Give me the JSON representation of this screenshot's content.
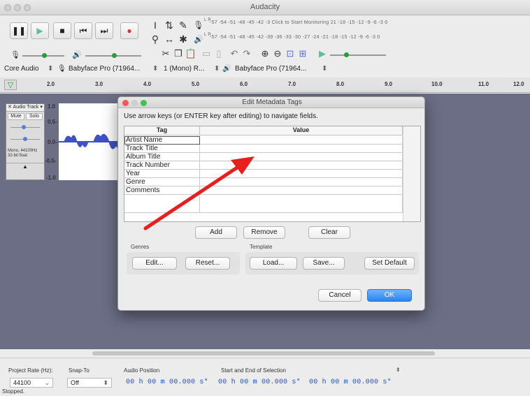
{
  "window": {
    "title": "Audacity"
  },
  "toolbar": {
    "transport": [
      "pause-icon",
      "play-icon",
      "stop-icon",
      "skip-start-icon",
      "skip-end-icon",
      "record-icon"
    ],
    "meter_rec_scale": "-57 -54 -51 -48 -45 -42 -3 Click to Start Monitoring 21 -18 -15 -12 -9 -6 -3 0",
    "meter_play_scale": "-57 -54 -51 -48 -45 -42 -39 -36 -33 -30 -27 -24 -21 -18 -15 -12 -9 -6 -3 0",
    "meter_rec_lr": "L\nR",
    "meter_play_lr": "L\nR"
  },
  "devices": {
    "host": "Core Audio",
    "input": "Babyface Pro (71964...",
    "channels": "1 (Mono) R...",
    "output": "Babyface Pro (71964..."
  },
  "ruler": {
    "ticks": [
      "2.0",
      "3.0",
      "4.0",
      "5.0",
      "6.0",
      "7.0",
      "8.0",
      "9.0",
      "10.0",
      "11.0",
      "12.0"
    ]
  },
  "track": {
    "name": "Audio Track",
    "mute": "Mute",
    "solo": "Solo",
    "info": "Mono, 44100Hz\n32-bit float",
    "scale": [
      "1.0",
      "0.5-",
      "0.0-",
      "-0.5-",
      "-1.0"
    ]
  },
  "dialog": {
    "title": "Edit Metadata Tags",
    "instruction": "Use arrow keys (or ENTER key after editing) to navigate fields.",
    "col_tag": "Tag",
    "col_value": "Value",
    "rows": [
      {
        "tag": "Artist Name",
        "value": ""
      },
      {
        "tag": "Track Title",
        "value": ""
      },
      {
        "tag": "Album Title",
        "value": ""
      },
      {
        "tag": "Track Number",
        "value": ""
      },
      {
        "tag": "Year",
        "value": ""
      },
      {
        "tag": "Genre",
        "value": ""
      },
      {
        "tag": "Comments",
        "value": ""
      },
      {
        "tag": "",
        "value": ""
      }
    ],
    "add": "Add",
    "remove": "Remove",
    "clear": "Clear",
    "genres_label": "Genres",
    "template_label": "Template",
    "edit": "Edit...",
    "reset": "Reset...",
    "load": "Load...",
    "save": "Save...",
    "set_default": "Set Default",
    "cancel": "Cancel",
    "ok": "OK"
  },
  "bottom": {
    "project_rate_label": "Project Rate (Hz):",
    "project_rate": "44100",
    "snap_label": "Snap-To",
    "snap": "Off",
    "audio_position_label": "Audio Position",
    "selection_label": "Start and End of Selection",
    "audio_position": "00 h 00 m 00.000 s*",
    "sel_start": "00 h 00 m 00.000 s*",
    "sel_end": "00 h 00 m 00.000 s*",
    "status": "Stopped."
  },
  "colors": {
    "accent": "#2a84f2",
    "annotation_arrow": "#e81f1f",
    "wave": "#3e52c8",
    "track_bg": "#6c6e86"
  }
}
